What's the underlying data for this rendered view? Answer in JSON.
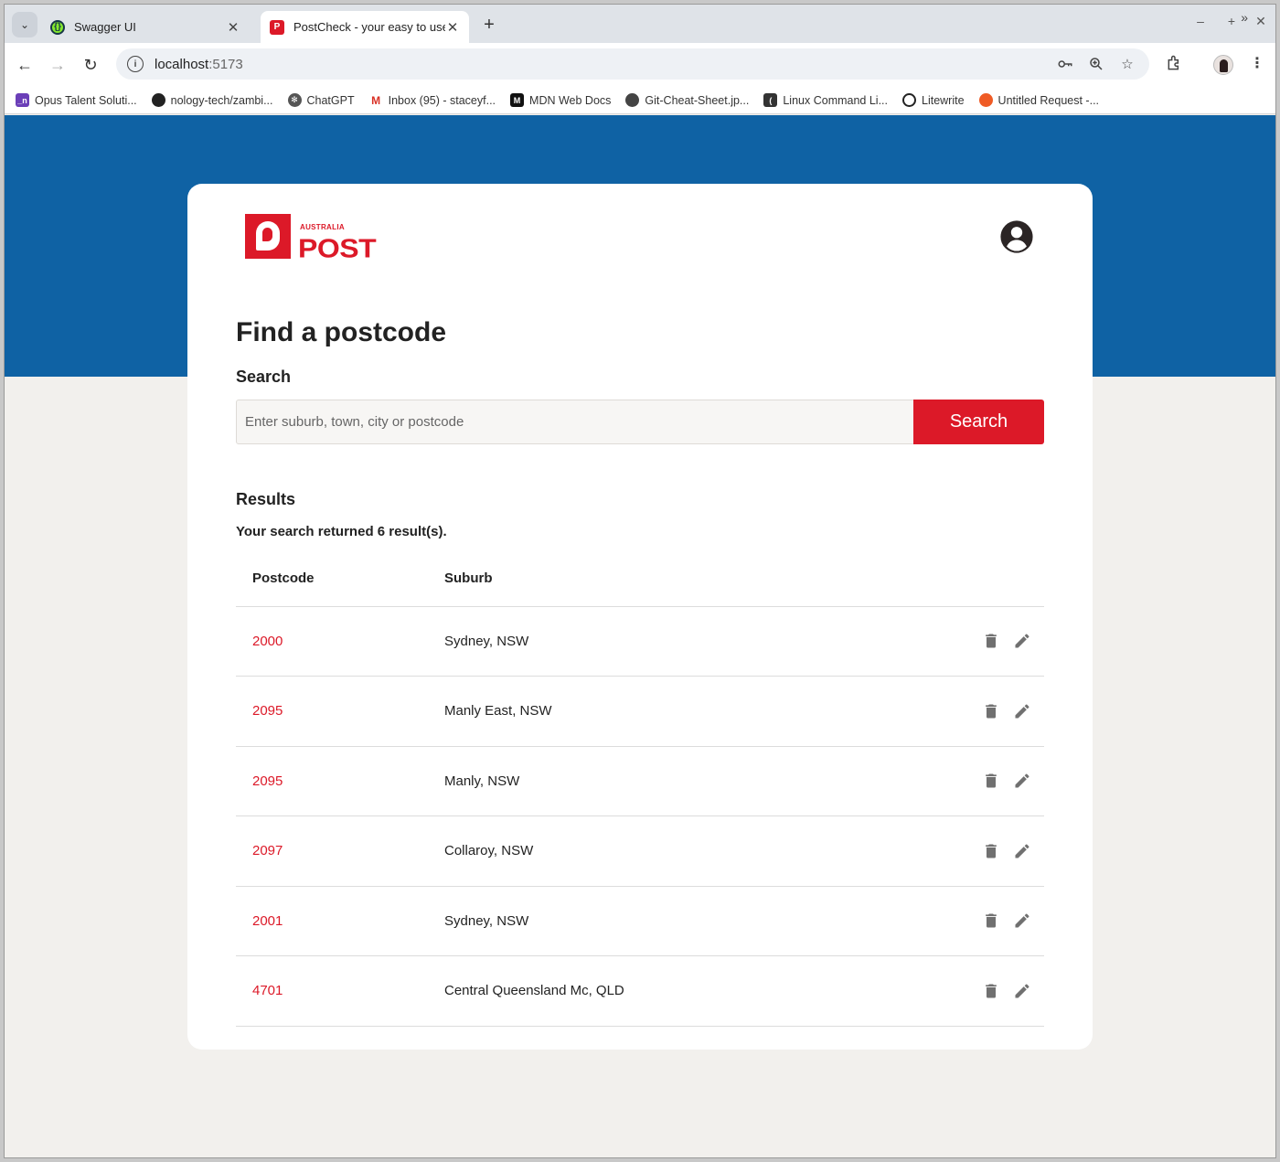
{
  "browser": {
    "tabs": [
      {
        "title": "Swagger UI",
        "active": false
      },
      {
        "title": "PostCheck - your easy to use postcode checker",
        "active": true
      }
    ],
    "url_host": "localhost",
    "url_port": ":5173",
    "bookmarks": [
      {
        "label": "Opus Talent Soluti...",
        "icon": "opus-icon",
        "color": "#6b3fb8"
      },
      {
        "label": "nology-tech/zambi...",
        "icon": "github-icon",
        "color": "#222222"
      },
      {
        "label": "ChatGPT",
        "icon": "chatgpt-icon",
        "color": "#555555"
      },
      {
        "label": "Inbox (95) - staceyf...",
        "icon": "gmail-icon",
        "color": "#d93025"
      },
      {
        "label": "MDN Web Docs",
        "icon": "mdn-icon",
        "color": "#111111"
      },
      {
        "label": "Git-Cheat-Sheet.jp...",
        "icon": "globe-icon",
        "color": "#444444"
      },
      {
        "label": "Linux Command Li...",
        "icon": "linux-icon",
        "color": "#333333"
      },
      {
        "label": "Litewrite",
        "icon": "circle-icon",
        "color": "#222222"
      },
      {
        "label": "Untitled Request -...",
        "icon": "postman-icon",
        "color": "#ef5b25"
      }
    ]
  },
  "page": {
    "brand": {
      "small": "AUSTRALIA",
      "big": "POST",
      "color": "#dc1928"
    },
    "header_bg": "#0f62a4",
    "title": "Find a postcode",
    "search": {
      "label": "Search",
      "placeholder": "Enter suburb, town, city or postcode",
      "value": "",
      "button_label": "Search"
    },
    "results": {
      "title": "Results",
      "summary": "Your search returned 6 result(s).",
      "columns": [
        "Postcode",
        "Suburb"
      ],
      "rows": [
        {
          "postcode": "2000",
          "suburb": "Sydney, NSW"
        },
        {
          "postcode": "2095",
          "suburb": "Manly East, NSW"
        },
        {
          "postcode": "2095",
          "suburb": "Manly, NSW"
        },
        {
          "postcode": "2097",
          "suburb": "Collaroy, NSW"
        },
        {
          "postcode": "2001",
          "suburb": "Sydney, NSW"
        },
        {
          "postcode": "4701",
          "suburb": "Central Queensland Mc, QLD"
        }
      ]
    }
  }
}
